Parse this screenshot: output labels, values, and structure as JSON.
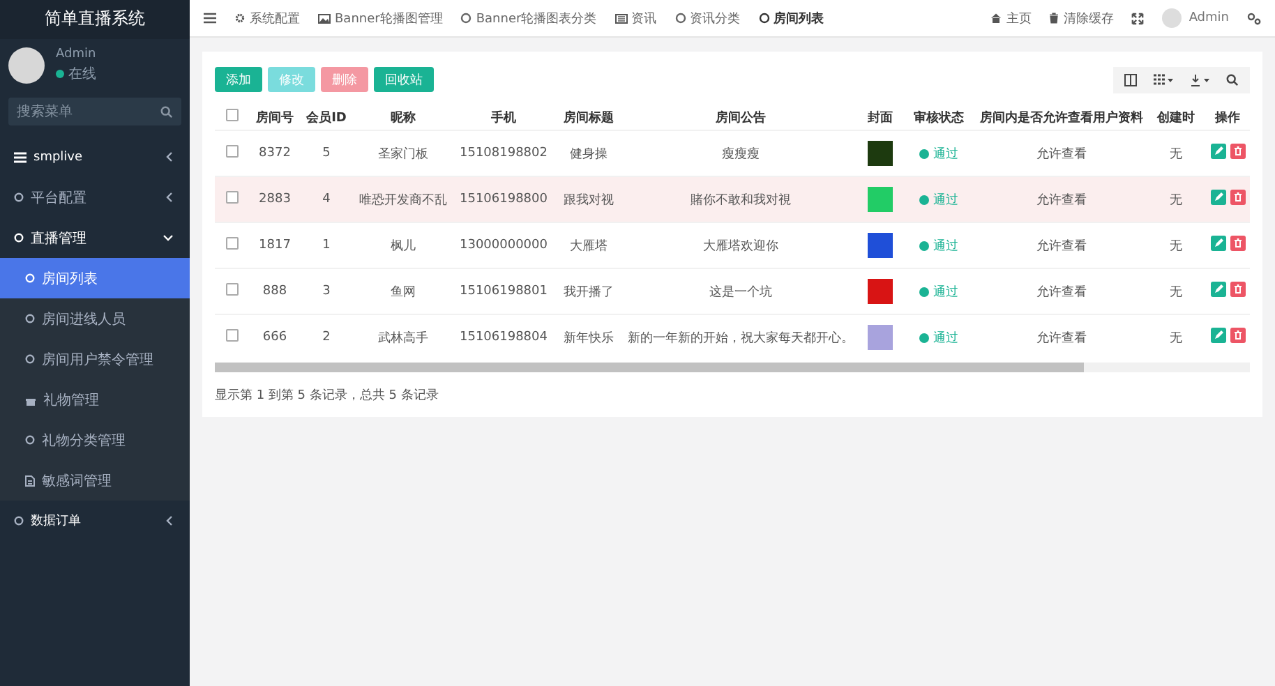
{
  "sidebar": {
    "title": "简单直播系统",
    "user": {
      "name": "Admin",
      "status": "在线"
    },
    "search": {
      "placeholder": "搜索菜单"
    },
    "menu": [
      {
        "label": "smplive",
        "children": [
          {
            "label": "平台配置",
            "expanded": false
          },
          {
            "label": "直播管理",
            "expanded": true,
            "children": [
              {
                "label": "房间列表",
                "selected": true
              },
              {
                "label": "房间进线人员",
                "selected": false
              },
              {
                "label": "房间用户禁令管理",
                "selected": false
              },
              {
                "label": "礼物管理",
                "selected": false
              },
              {
                "label": "礼物分类管理",
                "selected": false
              },
              {
                "label": "敏感词管理",
                "selected": false
              }
            ]
          }
        ]
      },
      {
        "label": "数据订单"
      }
    ]
  },
  "topbar": {
    "tabs": [
      {
        "label": "系统配置",
        "selected": false
      },
      {
        "label": "Banner轮播图管理",
        "selected": false
      },
      {
        "label": "Banner轮播图表分类",
        "selected": false
      },
      {
        "label": "资讯",
        "selected": false
      },
      {
        "label": "资讯分类",
        "selected": false
      },
      {
        "label": "房间列表",
        "selected": true
      }
    ],
    "right": [
      "主页",
      "清除缓存"
    ],
    "user": "Admin"
  },
  "toolbar": {
    "buttons": [
      {
        "label": "添加",
        "kind": "add",
        "disabled": false
      },
      {
        "label": "修改",
        "kind": "edit",
        "disabled": true
      },
      {
        "label": "删除",
        "kind": "delete",
        "disabled": true
      },
      {
        "label": "回收站",
        "kind": "recycle",
        "disabled": false
      }
    ]
  },
  "table": {
    "all_checked": false,
    "columns": [
      "房间号",
      "会员ID",
      "昵称",
      "手机",
      "房间标题",
      "房间公告",
      "封面",
      "审核状态",
      "房间内是否允许查看用户资料",
      "创建时",
      "操作"
    ],
    "rows": [
      {
        "selected": false,
        "checked": false,
        "cells": [
          "8372",
          "5",
          "圣家门板",
          "15108198802",
          "健身操",
          "瘦瘦瘦"
        ],
        "cover": {
          "color": "#1d3a0f"
        },
        "status": "通过",
        "permission": "允许查看",
        "created": "无"
      },
      {
        "selected": true,
        "checked": false,
        "cells": [
          "2883",
          "4",
          "唯恐开发商不乱",
          "15106198800",
          "跟我对视",
          "賭你不敢和我对視"
        ],
        "cover": {
          "color": "#22cc66"
        },
        "status": "通过",
        "permission": "允许查看",
        "created": "无"
      },
      {
        "selected": false,
        "checked": false,
        "cells": [
          "1817",
          "1",
          "枫儿",
          "13000000000",
          "大雁塔",
          "大雁塔欢迎你"
        ],
        "cover": {
          "color": "#1f4fd8"
        },
        "status": "通过",
        "permission": "允许查看",
        "created": "无"
      },
      {
        "selected": false,
        "checked": false,
        "cells": [
          "888",
          "3",
          "鱼网",
          "15106198801",
          "我开播了",
          "这是一个坑"
        ],
        "cover": {
          "color": "#d81414"
        },
        "status": "通过",
        "permission": "允许查看",
        "created": "无"
      },
      {
        "selected": false,
        "checked": false,
        "cells": [
          "666",
          "2",
          "武林高手",
          "15106198804",
          "新年快乐",
          "新的一年新的开始，祝大家每天都开心。"
        ],
        "cover": {
          "color": "#a8a3dd"
        },
        "status": "通过",
        "permission": "允许查看",
        "created": "无"
      }
    ],
    "footer": "显示第 1 到第 5 条记录，总共 5 条记录"
  }
}
